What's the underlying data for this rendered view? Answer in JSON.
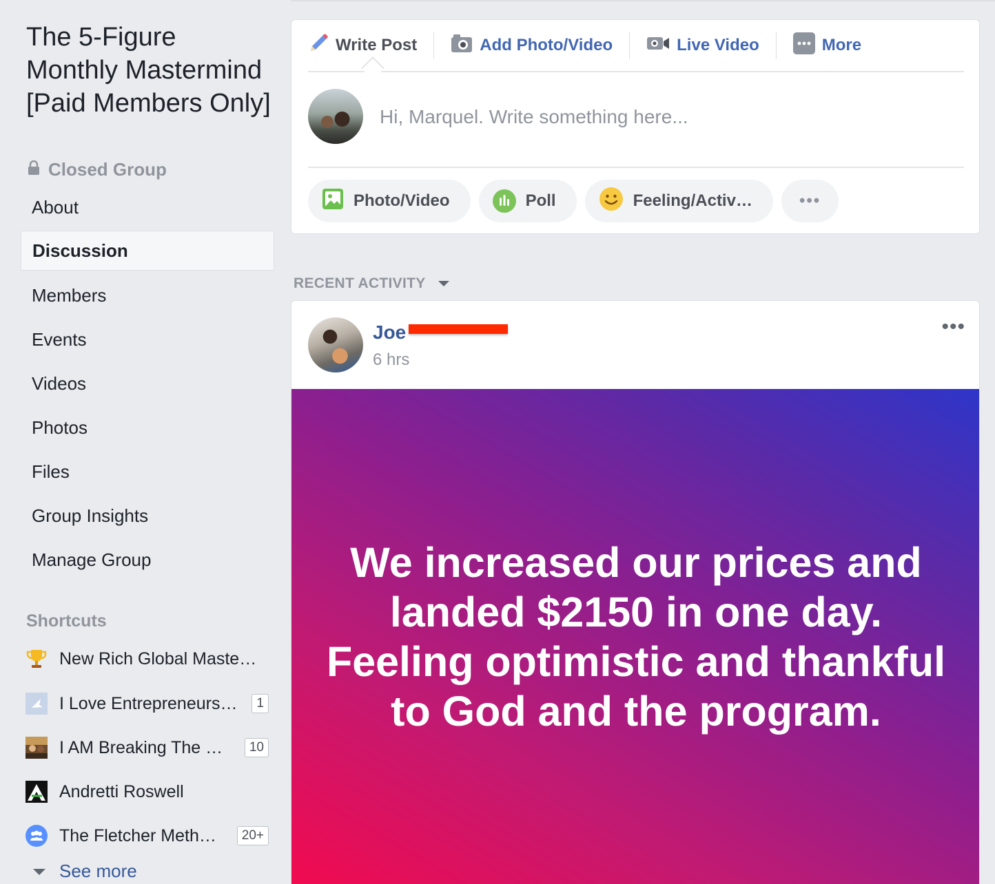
{
  "group": {
    "title": "The 5-Figure Monthly Mastermind [Paid Members Only]",
    "privacy": "Closed Group"
  },
  "nav": [
    {
      "label": "About"
    },
    {
      "label": "Discussion",
      "active": true
    },
    {
      "label": "Members"
    },
    {
      "label": "Events"
    },
    {
      "label": "Videos"
    },
    {
      "label": "Photos"
    },
    {
      "label": "Files"
    },
    {
      "label": "Group Insights"
    },
    {
      "label": "Manage Group"
    }
  ],
  "shortcuts": {
    "heading": "Shortcuts",
    "items": [
      {
        "label": "New Rich Global Maste…",
        "badge": ""
      },
      {
        "label": "I Love Entrepreneurs…",
        "badge": "1"
      },
      {
        "label": "I AM Breaking The …",
        "badge": "10"
      },
      {
        "label": "Andretti Roswell",
        "badge": ""
      },
      {
        "label": "The Fletcher Meth…",
        "badge": "20+"
      }
    ],
    "see_more": "See more"
  },
  "composer": {
    "tabs": {
      "write_post": "Write Post",
      "add_photo_video": "Add Photo/Video",
      "live_video": "Live Video",
      "more": "More"
    },
    "placeholder": "Hi, Marquel. Write something here...",
    "chips": {
      "photo_video": "Photo/Video",
      "poll": "Poll",
      "feeling": "Feeling/Activ…",
      "more": "•••"
    }
  },
  "feed": {
    "section_label": "RECENT ACTIVITY"
  },
  "post": {
    "author": "Joe",
    "time": "6 hrs",
    "menu": "•••",
    "text": "We increased our prices and landed $2150 in one day. Feeling optimistic and thankful to God and the program."
  },
  "colors": {
    "page_bg": "#e9ebee",
    "link_blue": "#365899",
    "tab_blue": "#4267b2",
    "muted_gray": "#90949c",
    "gradient_start": "#f10a4f",
    "gradient_end": "#2e35c9",
    "redaction": "#ff2a00"
  },
  "icons": {
    "write_post": "pencil-icon",
    "add_photo_video": "camera-icon",
    "live_video": "video-camera-icon",
    "more": "more-dots-icon",
    "privacy": "lock-icon",
    "photo_chip": "photo-icon",
    "poll_chip": "poll-icon",
    "feeling_chip": "smiley-icon",
    "recent_caret": "caret-down-icon"
  }
}
